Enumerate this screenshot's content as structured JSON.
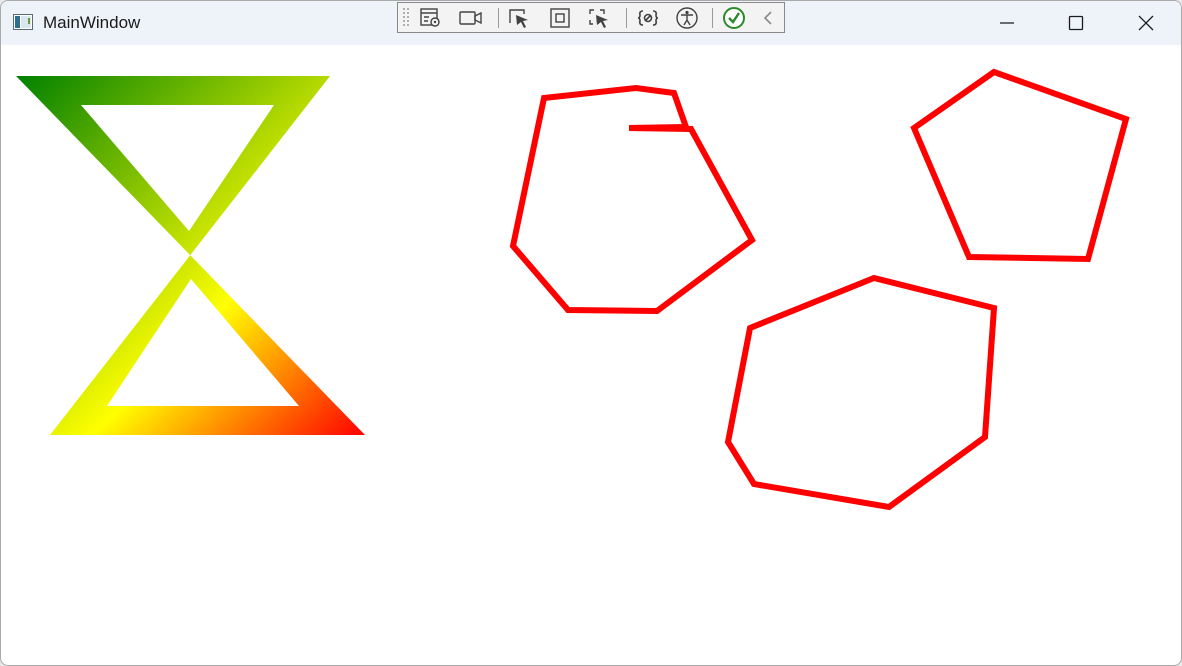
{
  "window": {
    "title": "MainWindow",
    "icon": "app-window-icon"
  },
  "debug_toolbar": {
    "buttons": [
      {
        "name": "live-visual-tree-icon",
        "tooltip": ""
      },
      {
        "name": "record-icon"
      },
      {
        "name": "select-element-icon"
      },
      {
        "name": "display-layout-adorners-icon"
      },
      {
        "name": "track-focused-element-icon"
      },
      {
        "name": "binding-failures-icon"
      },
      {
        "name": "accessibility-icon"
      },
      {
        "name": "hot-reload-ok-icon"
      },
      {
        "name": "collapse-chevron-icon"
      }
    ]
  },
  "title_buttons": [
    "minimize-icon",
    "maximize-icon",
    "close-icon"
  ],
  "colors": {
    "titlebar": "#eef2f9",
    "shape_stroke": "#ff0000",
    "gradient_start": "#008000",
    "gradient_mid": "#ffff00",
    "gradient_end": "#ff0000"
  },
  "shapes": [
    {
      "name": "hourglass-shape",
      "kind": "gradient-hourglass"
    },
    {
      "name": "concave-polygon-shape",
      "kind": "outline"
    },
    {
      "name": "pentagon-shape",
      "kind": "outline"
    },
    {
      "name": "hexagon-shape",
      "kind": "outline"
    }
  ]
}
